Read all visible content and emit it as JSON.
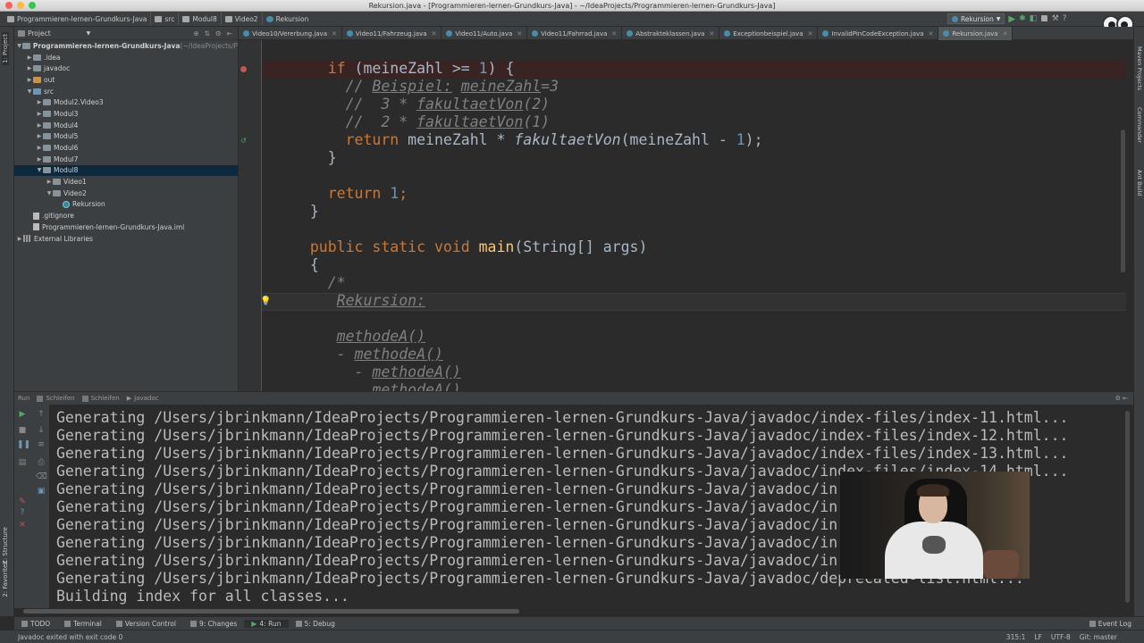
{
  "window": {
    "title": "Rekursion.java - [Programmieren-lernen-Grundkurs-Java] - ~/IdeaProjects/Programmieren-lernen-Grundkurs-Java]"
  },
  "breadcrumbs": [
    "Programmieren-lernen-Grundkurs-Java",
    "src",
    "Modul8",
    "Video2",
    "Rekursion"
  ],
  "run_config": {
    "label": "Rekursion"
  },
  "left_strip": {
    "project_tab": "1: Project",
    "structure_tab": "Z: Structure",
    "favorites_tab": "2: Favorites"
  },
  "right_strip": {
    "maven_tab": "Maven Projects",
    "commander_tab": "Commander",
    "ant_tab": "Ant Build"
  },
  "project_panel": {
    "header": "Project",
    "tree": [
      {
        "label": "Programmieren-lernen-Grundkurs-Java",
        "suffix": " (~/IdeaProjects/P",
        "depth": 0,
        "arrow": "▼",
        "icon": "folder"
      },
      {
        "label": ".idea",
        "depth": 1,
        "arrow": "▶",
        "icon": "folder"
      },
      {
        "label": "javadoc",
        "depth": 1,
        "arrow": "▶",
        "icon": "folder"
      },
      {
        "label": "out",
        "depth": 1,
        "arrow": "▶",
        "icon": "folder-orange"
      },
      {
        "label": "src",
        "depth": 1,
        "arrow": "▼",
        "icon": "folder-blue"
      },
      {
        "label": "Modul2.Video3",
        "depth": 2,
        "arrow": "▶",
        "icon": "folder"
      },
      {
        "label": "Modul3",
        "depth": 2,
        "arrow": "▶",
        "icon": "folder"
      },
      {
        "label": "Modul4",
        "depth": 2,
        "arrow": "▶",
        "icon": "folder"
      },
      {
        "label": "Modul5",
        "depth": 2,
        "arrow": "▶",
        "icon": "folder"
      },
      {
        "label": "Modul6",
        "depth": 2,
        "arrow": "▶",
        "icon": "folder"
      },
      {
        "label": "Modul7",
        "depth": 2,
        "arrow": "▶",
        "icon": "folder"
      },
      {
        "label": "Modul8",
        "depth": 2,
        "arrow": "▼",
        "icon": "folder",
        "selected": true
      },
      {
        "label": "Video1",
        "depth": 3,
        "arrow": "▶",
        "icon": "folder"
      },
      {
        "label": "Video2",
        "depth": 3,
        "arrow": "▼",
        "icon": "folder"
      },
      {
        "label": "Rekursion",
        "depth": 4,
        "arrow": "",
        "icon": "class"
      },
      {
        "label": ".gitignore",
        "depth": 1,
        "arrow": "",
        "icon": "file"
      },
      {
        "label": "Programmieren-lernen-Grundkurs-Java.iml",
        "depth": 1,
        "arrow": "",
        "icon": "file"
      },
      {
        "label": "External Libraries",
        "depth": 0,
        "arrow": "▶",
        "icon": "lib"
      }
    ]
  },
  "editor_tabs": [
    {
      "label": "Video10/Vererbung.java"
    },
    {
      "label": "Video11/Fahrzeug.java"
    },
    {
      "label": "Video11/Auto.java"
    },
    {
      "label": "Video11/Fahrrad.java"
    },
    {
      "label": "Abstrakteklassen.java"
    },
    {
      "label": "Exceptionbeispiel.java"
    },
    {
      "label": "InvalidPinCodeException.java"
    },
    {
      "label": "Rekursion.java",
      "active": true
    }
  ],
  "code": {
    "l1_if": "if",
    "l1_rest": " (meineZahl >= ",
    "l1_num": "1",
    "l1_end": ") {",
    "l2_a": "// ",
    "l2_b": "Beispiel:",
    "l2_c": " ",
    "l2_d": "meineZahl",
    "l2_e": "=3",
    "l3_a": "//  3 * ",
    "l3_b": "fakultaetVon",
    "l3_c": "(2)",
    "l4_a": "//  2 * ",
    "l4_b": "fakultaetVon",
    "l4_c": "(1)",
    "l5_kw": "return",
    "l5_a": " meineZahl * ",
    "l5_fn": "fakultaetVon",
    "l5_b": "(meineZahl - ",
    "l5_num": "1",
    "l5_c": ");",
    "l6": "}",
    "l8_kw": "return",
    "l8_num": "1",
    "l8_end": ";",
    "l9": "}",
    "l11_kw": "public static void",
    "l11_fn": "main",
    "l11_rest": "(String[] args)",
    "l12": "{",
    "l13": "/*",
    "l14": "Rekursion:",
    "l16": "methodeA()",
    "l17_a": "- ",
    "l17_b": "methodeA()",
    "l18_a": "- ",
    "l18_b": "methodeA()",
    "l19": "methodeA()"
  },
  "run_panel": {
    "header_tabs": [
      "Run",
      "Schleifen",
      "Schleifen",
      "Javadoc"
    ],
    "lines": [
      "Generating /Users/jbrinkmann/IdeaProjects/Programmieren-lernen-Grundkurs-Java/javadoc/index-files/index-11.html...",
      "Generating /Users/jbrinkmann/IdeaProjects/Programmieren-lernen-Grundkurs-Java/javadoc/index-files/index-12.html...",
      "Generating /Users/jbrinkmann/IdeaProjects/Programmieren-lernen-Grundkurs-Java/javadoc/index-files/index-13.html...",
      "Generating /Users/jbrinkmann/IdeaProjects/Programmieren-lernen-Grundkurs-Java/javadoc/index-files/index-14.html...",
      "Generating /Users/jbrinkmann/IdeaProjects/Programmieren-lernen-Grundkurs-Java/javadoc/in",
      "Generating /Users/jbrinkmann/IdeaProjects/Programmieren-lernen-Grundkurs-Java/javadoc/in",
      "Generating /Users/jbrinkmann/IdeaProjects/Programmieren-lernen-Grundkurs-Java/javadoc/in",
      "Generating /Users/jbrinkmann/IdeaProjects/Programmieren-lernen-Grundkurs-Java/javadoc/in",
      "Generating /Users/jbrinkmann/IdeaProjects/Programmieren-lernen-Grundkurs-Java/javadoc/in",
      "Generating /Users/jbrinkmann/IdeaProjects/Programmieren-lernen-Grundkurs-Java/javadoc/deprecated-list.html...",
      "Building index for all classes..."
    ]
  },
  "bottom_tabs": [
    {
      "label": "TODO"
    },
    {
      "label": "Terminal"
    },
    {
      "label": "Version Control"
    },
    {
      "label": "9: Changes"
    },
    {
      "label": "4: Run",
      "active": true
    },
    {
      "label": "5: Debug"
    }
  ],
  "event_log": "Event Log",
  "status": {
    "message": "Javadoc exited with exit code 0",
    "position": "315:1",
    "line_sep": "LF",
    "encoding": "UTF-8",
    "git": "Git: master"
  },
  "colors": {
    "keyword": "#cc7832",
    "number": "#6897bb",
    "comment": "#808080",
    "method": "#ffc66d",
    "selection": "#0d293e",
    "breakpoint": "#c75450"
  }
}
